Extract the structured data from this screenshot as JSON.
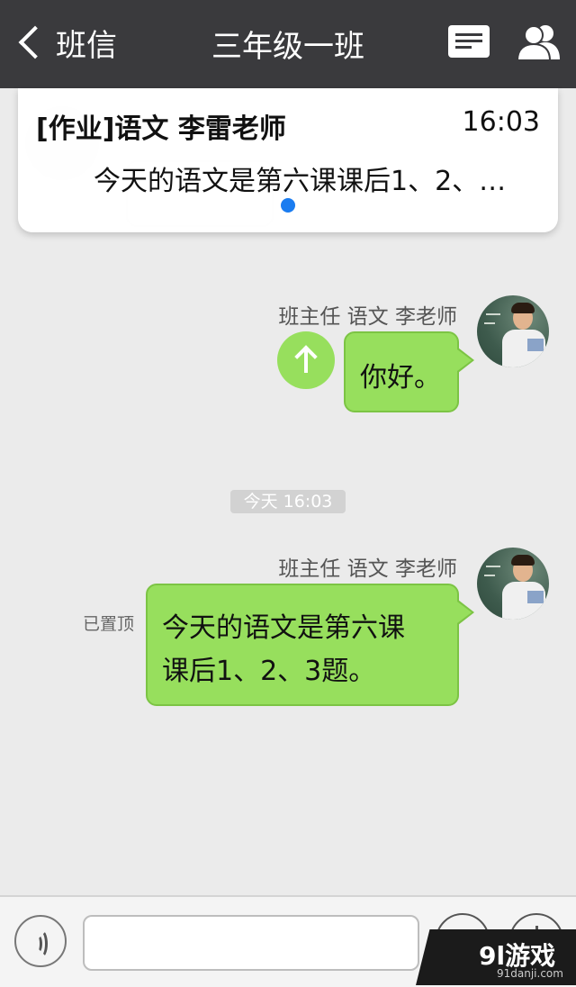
{
  "header": {
    "back_label": "班信",
    "title": "三年级一班"
  },
  "pinned": {
    "title": "[作业]语文 李雷老师",
    "time": "16:03",
    "preview": "今天的语文是第六课课后1、2、…"
  },
  "messages": [
    {
      "sender": "班主任 语文 李老师",
      "text": "你好。"
    },
    {
      "timestamp": "今天 16:03",
      "sender": "班主任 语文 李老师",
      "status": "已置顶",
      "lines": [
        "今天的语文是第六课",
        "课后1、2、3题。"
      ]
    }
  ],
  "input": {
    "placeholder": ""
  },
  "colors": {
    "navbar": "#3a3a3d",
    "bubble": "#97df5d",
    "dot": "#1a7cf0"
  },
  "watermark": {
    "main": "9l游戏",
    "sub": "91danji.com"
  }
}
